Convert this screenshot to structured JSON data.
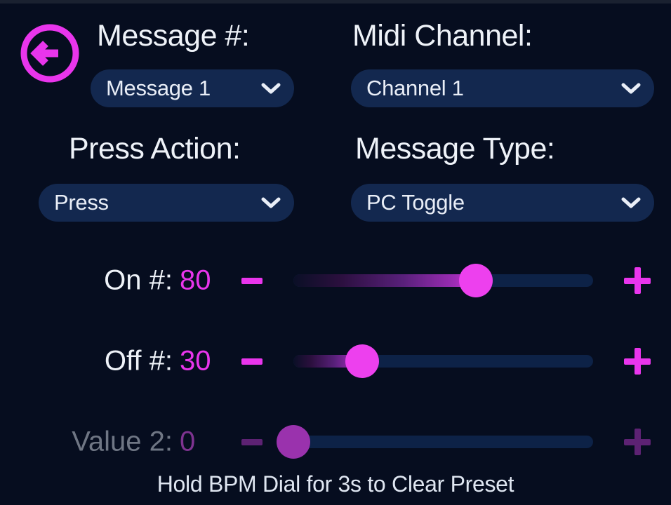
{
  "theme": {
    "background": "#060d1f",
    "accent": "#e935ec",
    "dropdown_bg": "#13284f",
    "text": "#eef2f8",
    "track_bg": "#0d2247",
    "disabled_text": "#6f7684",
    "disabled_accent": "#5d2273"
  },
  "nav": {
    "back_icon": "arrow-left-circle-icon"
  },
  "fields": {
    "message_number": {
      "label": "Message #:",
      "value": "Message 1",
      "chevron_icon": "chevron-down-icon"
    },
    "midi_channel": {
      "label": "Midi Channel:",
      "value": "Channel 1",
      "chevron_icon": "chevron-down-icon"
    },
    "press_action": {
      "label": "Press Action:",
      "value": "Press",
      "chevron_icon": "chevron-down-icon"
    },
    "message_type": {
      "label": "Message Type:",
      "value": "PC Toggle",
      "chevron_icon": "chevron-down-icon"
    }
  },
  "sliders": [
    {
      "label": "On #:",
      "value": "80",
      "percent": 61,
      "minus_icon": "minus-icon",
      "plus_icon": "plus-icon",
      "disabled": false
    },
    {
      "label": "Off #:",
      "value": "30",
      "percent": 23,
      "minus_icon": "minus-icon",
      "plus_icon": "plus-icon",
      "disabled": false
    },
    {
      "label": "Value 2:",
      "value": "0",
      "percent": 0,
      "minus_icon": "minus-icon",
      "plus_icon": "plus-icon",
      "disabled": true
    }
  ],
  "footer": {
    "hint": "Hold BPM Dial for 3s to Clear Preset"
  }
}
